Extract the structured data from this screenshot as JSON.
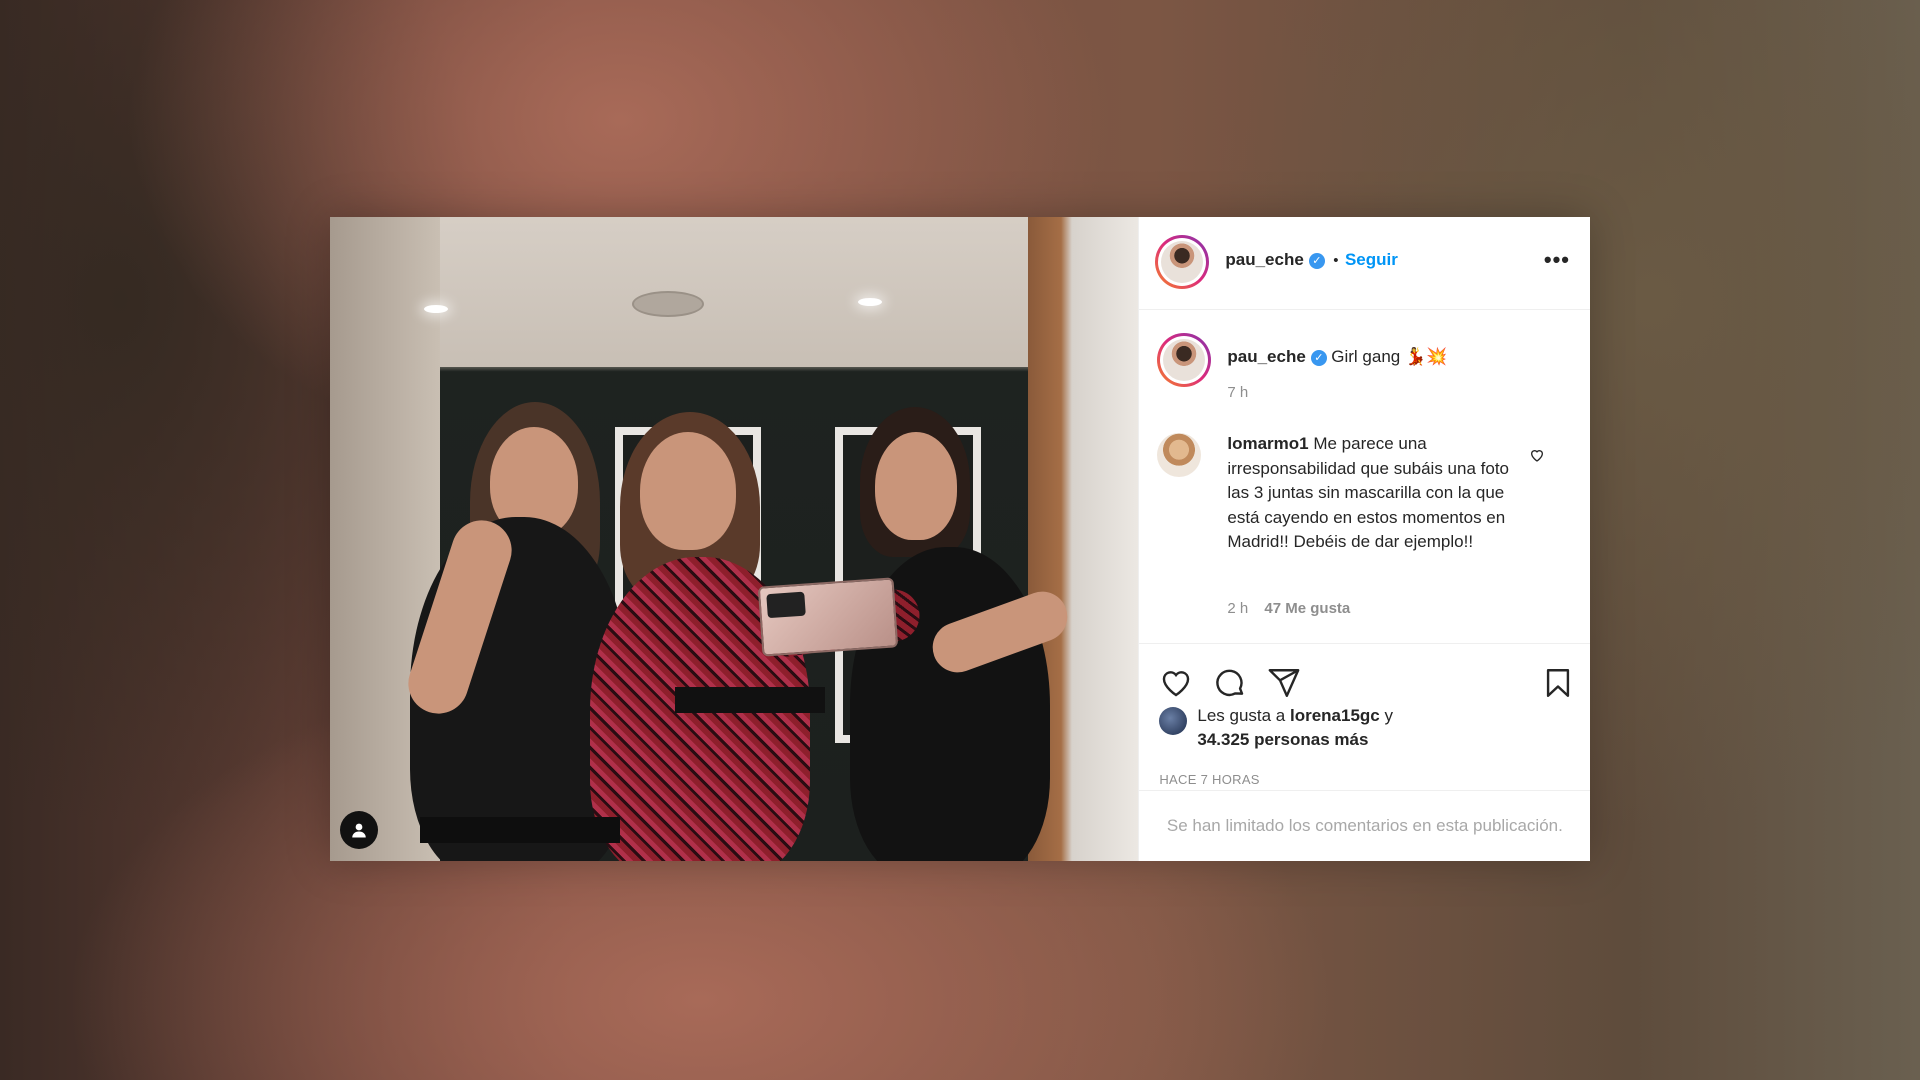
{
  "post": {
    "author": "pau_eche",
    "follow_label": "Seguir",
    "separator": "•",
    "more_icon": "more-options-icon"
  },
  "caption": {
    "author": "pau_eche",
    "text": "Girl gang 💃💥",
    "time": "7 h"
  },
  "comment": {
    "author": "lomarmo1",
    "text": "Me parece una irresponsabilidad que subáis una foto las 3 juntas sin mascarilla con la que está cayendo en estos momentos en Madrid!! Debéis de dar ejemplo!!",
    "time": "2 h",
    "likes": "47 Me gusta"
  },
  "likes": {
    "prefix": "Les gusta a ",
    "user": "lorena15gc",
    "connector": " y",
    "others": "34.325 personas más"
  },
  "posted_ago": "HACE 7 HORAS",
  "comments_limited": "Se han limitado los comentarios en esta publicación.",
  "colors": {
    "link": "#0095f6",
    "verified": "#3897f0"
  }
}
